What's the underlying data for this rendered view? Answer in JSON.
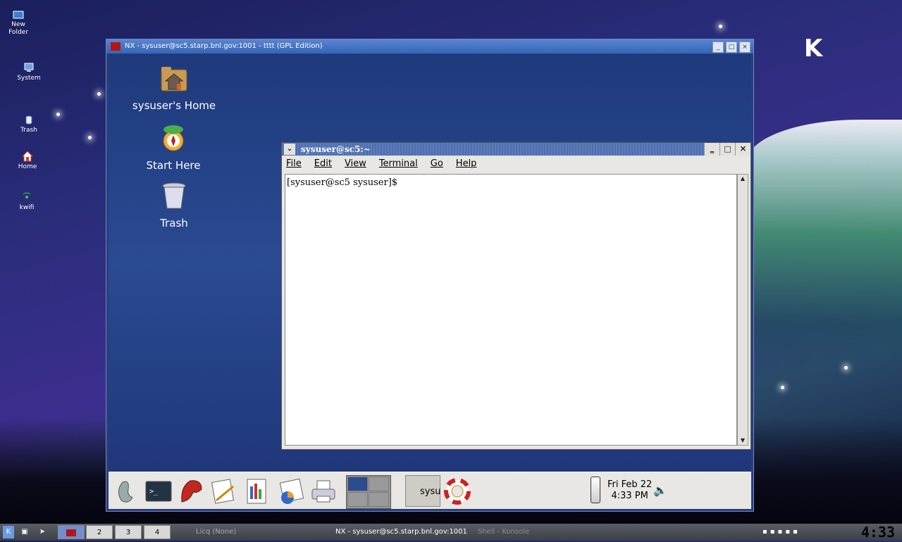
{
  "desktop": {
    "icons": [
      {
        "label": "New\nFolder",
        "icon": "folder-icon"
      },
      {
        "label": "System",
        "icon": "computer-icon"
      },
      {
        "label": "Trash",
        "icon": "trash-icon"
      },
      {
        "label": "Home",
        "icon": "home-icon"
      },
      {
        "label": "kwifi",
        "icon": "wifi-icon"
      }
    ]
  },
  "nx_window": {
    "title": "NX - sysuser@sc5.starp.bnl.gov:1001 - tttt (GPL Edition)",
    "buttons": [
      "_",
      "□",
      "×"
    ]
  },
  "gnome_desktop": {
    "icons": [
      {
        "label": "sysuser's Home"
      },
      {
        "label": "Start Here"
      },
      {
        "label": "Trash"
      }
    ]
  },
  "terminal": {
    "title": "sysuser@sc5:~",
    "menu": [
      "File",
      "Edit",
      "View",
      "Terminal",
      "Go",
      "Help"
    ],
    "prompt": "[sysuser@sc5 sysuser]$"
  },
  "gnome_panel": {
    "task_label": "sysu",
    "clock_date": "Fri Feb 22",
    "clock_time": "4:33 PM"
  },
  "kde_taskbar": {
    "workspaces": [
      "2",
      "3",
      "4"
    ],
    "tasks": [
      {
        "label": "Licq (None)"
      },
      {
        "label": "NX - sysuser@sc5.starp.bnl.gov:1001"
      },
      {
        "label": "Shell - Konsole"
      }
    ],
    "clock": "4:33"
  }
}
